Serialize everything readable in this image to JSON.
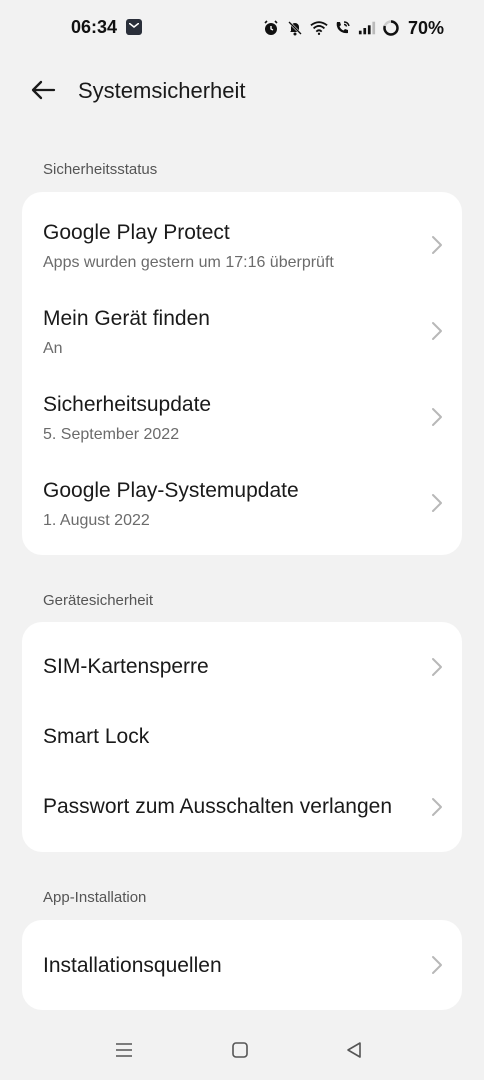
{
  "status_bar": {
    "time": "06:34",
    "battery": "70%",
    "icons": [
      "mail-icon",
      "alarm-icon",
      "muted-bell-icon",
      "wifi-icon",
      "wifi-calling-icon",
      "signal-icon",
      "battery-ring-icon"
    ]
  },
  "header": {
    "title": "Systemsicherheit",
    "back_icon": "arrow-left-icon"
  },
  "sections": [
    {
      "label": "Sicherheitsstatus",
      "items": [
        {
          "title": "Google Play Protect",
          "subtitle": "Apps wurden gestern um 17:16 überprüft"
        },
        {
          "title": "Mein Gerät finden",
          "subtitle": "An"
        },
        {
          "title": "Sicherheitsupdate",
          "subtitle": "5. September 2022"
        },
        {
          "title": "Google Play-Systemupdate",
          "subtitle": "1. August 2022"
        }
      ]
    },
    {
      "label": "Gerätesicherheit",
      "items": [
        {
          "title": "SIM-Kartensperre"
        },
        {
          "title": "Smart Lock"
        },
        {
          "title": "Passwort zum Ausschalten verlangen"
        }
      ]
    },
    {
      "label": "App-Installation",
      "items": [
        {
          "title": "Installationsquellen"
        }
      ]
    }
  ],
  "nav_bar": {
    "icons": [
      "menu-icon",
      "home-square-icon",
      "back-triangle-icon"
    ]
  },
  "colors": {
    "background": "#f2f2f2",
    "card": "#ffffff",
    "chevron": "#b8b8b8"
  }
}
